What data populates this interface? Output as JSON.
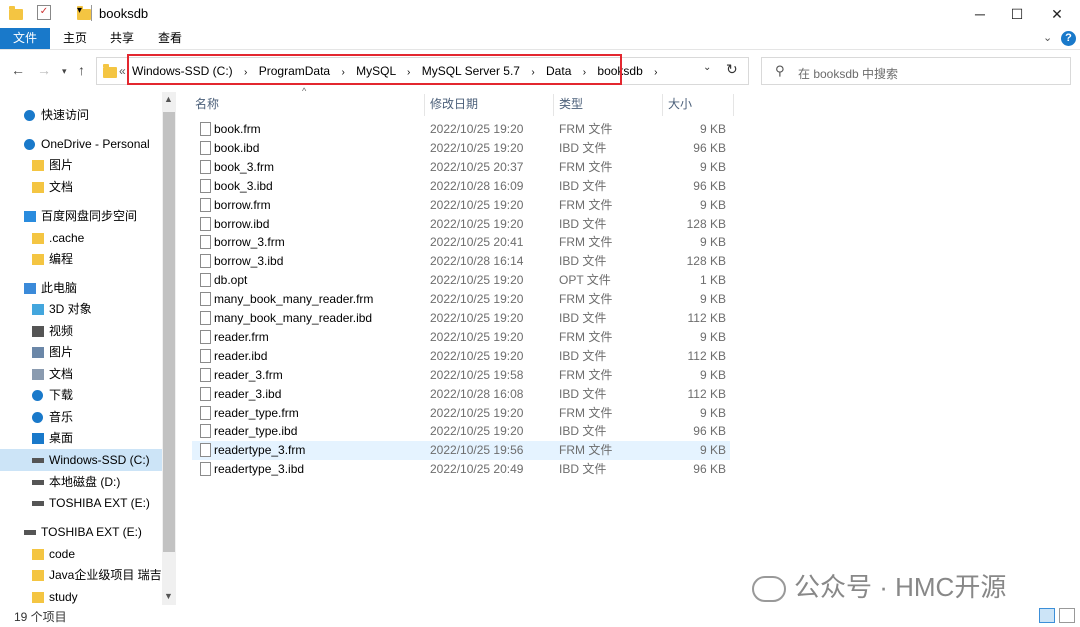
{
  "window": {
    "title": "booksdb"
  },
  "ribbon": {
    "tabs": [
      "文件",
      "主页",
      "共享",
      "查看"
    ]
  },
  "address": {
    "crumbs": [
      "Windows-SSD (C:)",
      "ProgramData",
      "MySQL",
      "MySQL Server 5.7",
      "Data",
      "booksdb"
    ],
    "overflow": "«"
  },
  "search": {
    "placeholder": "在 booksdb 中搜索"
  },
  "columns": {
    "name": "名称",
    "date": "修改日期",
    "type": "类型",
    "size": "大小"
  },
  "sidebar": [
    {
      "label": "快速访问",
      "icon": "star-icon"
    },
    {
      "label": "OneDrive - Personal",
      "icon": "cloud-icon"
    },
    {
      "label": "图片",
      "icon": "folder-icon"
    },
    {
      "label": "文档",
      "icon": "folder-icon"
    },
    {
      "label": "百度网盘同步空间",
      "icon": "baidu-icon"
    },
    {
      "label": ".cache",
      "icon": "folder-icon"
    },
    {
      "label": "编程",
      "icon": "folder-icon"
    },
    {
      "label": "此电脑",
      "icon": "pc-icon"
    },
    {
      "label": "3D 对象",
      "icon": "3d-icon"
    },
    {
      "label": "视频",
      "icon": "video-icon"
    },
    {
      "label": "图片",
      "icon": "pictures-icon"
    },
    {
      "label": "文档",
      "icon": "documents-icon"
    },
    {
      "label": "下载",
      "icon": "download-icon"
    },
    {
      "label": "音乐",
      "icon": "music-icon"
    },
    {
      "label": "桌面",
      "icon": "desktop-icon"
    },
    {
      "label": "Windows-SSD (C:)",
      "icon": "drive-icon"
    },
    {
      "label": "本地磁盘 (D:)",
      "icon": "drive-icon"
    },
    {
      "label": "TOSHIBA EXT (E:)",
      "icon": "drive-icon"
    },
    {
      "label": "TOSHIBA EXT (E:)",
      "icon": "drive-icon"
    },
    {
      "label": "code",
      "icon": "folder-icon"
    },
    {
      "label": "Java企业级项目 瑞吉外",
      "icon": "folder-icon"
    },
    {
      "label": "study",
      "icon": "folder-icon"
    }
  ],
  "files": [
    {
      "name": "book.frm",
      "date": "2022/10/25 19:20",
      "type": "FRM 文件",
      "size": "9 KB"
    },
    {
      "name": "book.ibd",
      "date": "2022/10/25 19:20",
      "type": "IBD 文件",
      "size": "96 KB"
    },
    {
      "name": "book_3.frm",
      "date": "2022/10/25 20:37",
      "type": "FRM 文件",
      "size": "9 KB"
    },
    {
      "name": "book_3.ibd",
      "date": "2022/10/28 16:09",
      "type": "IBD 文件",
      "size": "96 KB"
    },
    {
      "name": "borrow.frm",
      "date": "2022/10/25 19:20",
      "type": "FRM 文件",
      "size": "9 KB"
    },
    {
      "name": "borrow.ibd",
      "date": "2022/10/25 19:20",
      "type": "IBD 文件",
      "size": "128 KB"
    },
    {
      "name": "borrow_3.frm",
      "date": "2022/10/25 20:41",
      "type": "FRM 文件",
      "size": "9 KB"
    },
    {
      "name": "borrow_3.ibd",
      "date": "2022/10/28 16:14",
      "type": "IBD 文件",
      "size": "128 KB"
    },
    {
      "name": "db.opt",
      "date": "2022/10/25 19:20",
      "type": "OPT 文件",
      "size": "1 KB"
    },
    {
      "name": "many_book_many_reader.frm",
      "date": "2022/10/25 19:20",
      "type": "FRM 文件",
      "size": "9 KB"
    },
    {
      "name": "many_book_many_reader.ibd",
      "date": "2022/10/25 19:20",
      "type": "IBD 文件",
      "size": "112 KB"
    },
    {
      "name": "reader.frm",
      "date": "2022/10/25 19:20",
      "type": "FRM 文件",
      "size": "9 KB"
    },
    {
      "name": "reader.ibd",
      "date": "2022/10/25 19:20",
      "type": "IBD 文件",
      "size": "112 KB"
    },
    {
      "name": "reader_3.frm",
      "date": "2022/10/25 19:58",
      "type": "FRM 文件",
      "size": "9 KB"
    },
    {
      "name": "reader_3.ibd",
      "date": "2022/10/28 16:08",
      "type": "IBD 文件",
      "size": "112 KB"
    },
    {
      "name": "reader_type.frm",
      "date": "2022/10/25 19:20",
      "type": "FRM 文件",
      "size": "9 KB"
    },
    {
      "name": "reader_type.ibd",
      "date": "2022/10/25 19:20",
      "type": "IBD 文件",
      "size": "96 KB"
    },
    {
      "name": "readertype_3.frm",
      "date": "2022/10/25 19:56",
      "type": "FRM 文件",
      "size": "9 KB"
    },
    {
      "name": "readertype_3.ibd",
      "date": "2022/10/25 20:49",
      "type": "IBD 文件",
      "size": "96 KB"
    }
  ],
  "status": {
    "count": "19 个项目"
  },
  "watermark": {
    "text": "公众号 · HMC开源"
  },
  "colors": {
    "accent": "#1979ca",
    "highlight_box": "#e3272f",
    "selected": "#cce4f7"
  }
}
